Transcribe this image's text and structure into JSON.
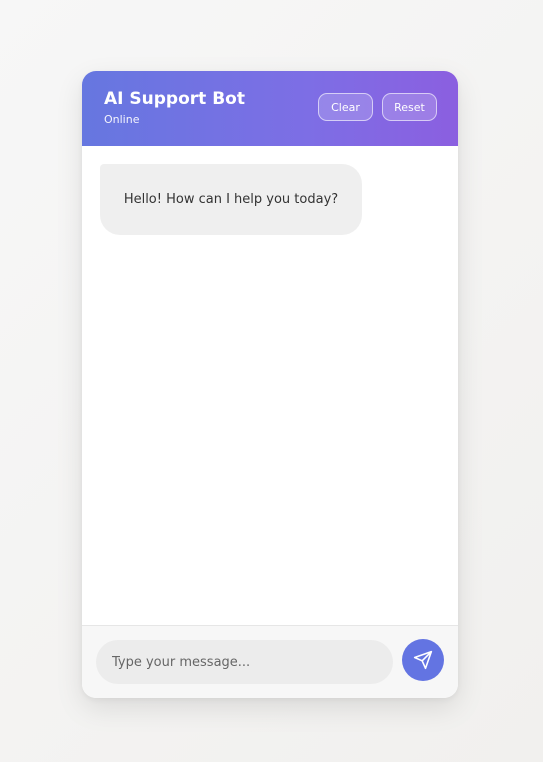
{
  "header": {
    "title": "AI Support Bot",
    "status": "Online",
    "clear_label": "Clear",
    "reset_label": "Reset"
  },
  "messages": [
    {
      "sender": "bot",
      "text": "Hello! How can I help you today?"
    }
  ],
  "composer": {
    "placeholder": "Type your message...",
    "value": ""
  },
  "icons": {
    "send": "send-icon"
  },
  "colors": {
    "header_start": "#6677e0",
    "header_end": "#8b5fe0",
    "send_button": "#6374e2",
    "bot_bubble": "#efefef"
  }
}
